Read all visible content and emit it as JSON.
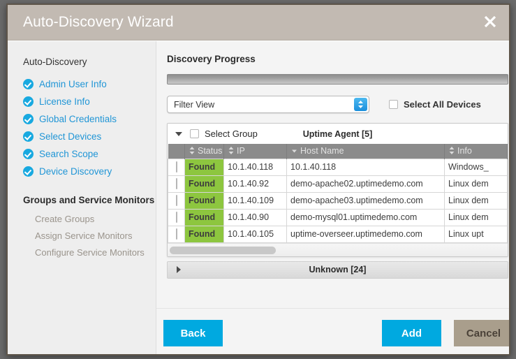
{
  "window": {
    "title": "Auto-Discovery Wizard",
    "close_icon": "close-icon"
  },
  "sidebar": {
    "section_title": "Auto-Discovery",
    "steps": [
      {
        "label": "Admin User Info",
        "icon": "check-circle-icon",
        "complete": true
      },
      {
        "label": "License Info",
        "icon": "check-circle-icon",
        "complete": true
      },
      {
        "label": "Global Credentials",
        "icon": "check-circle-icon",
        "complete": true
      },
      {
        "label": "Select Devices",
        "icon": "check-circle-icon",
        "complete": true
      },
      {
        "label": "Search Scope",
        "icon": "check-circle-icon",
        "complete": true
      },
      {
        "label": "Device Discovery",
        "icon": "check-circle-icon",
        "complete": true
      }
    ],
    "group_title": "Groups and Service Monitors",
    "group_items": [
      {
        "label": "Create Groups"
      },
      {
        "label": "Assign Service Monitors"
      },
      {
        "label": "Configure Service Monitors"
      }
    ]
  },
  "main": {
    "progress_label": "Discovery Progress",
    "progress_percent": 100,
    "filter": {
      "value": "Filter View",
      "chevron_icon": "updown-chevron-icon"
    },
    "select_all": {
      "label": "Select All Devices",
      "checked": false
    },
    "group_uptime": {
      "toggle_icon": "triangle-down-icon",
      "select_group_label": "Select Group",
      "select_group_checked": false,
      "title": "Uptime Agent [5]",
      "expanded": true
    },
    "table": {
      "columns": [
        {
          "key": "check",
          "label": "",
          "sort": "none"
        },
        {
          "key": "status",
          "label": "Status",
          "sort": "both"
        },
        {
          "key": "ip",
          "label": "IP",
          "sort": "both"
        },
        {
          "key": "host",
          "label": "Host Name",
          "sort": "desc"
        },
        {
          "key": "info",
          "label": "Info",
          "sort": "both"
        }
      ],
      "rows": [
        {
          "checked": false,
          "status": "Found",
          "ip": "10.1.40.118",
          "host": "10.1.40.118",
          "info": "Windows_"
        },
        {
          "checked": false,
          "status": "Found",
          "ip": "10.1.40.92",
          "host": "demo-apache02.uptimedemo.com",
          "info": "Linux dem"
        },
        {
          "checked": false,
          "status": "Found",
          "ip": "10.1.40.109",
          "host": "demo-apache03.uptimedemo.com",
          "info": "Linux dem"
        },
        {
          "checked": false,
          "status": "Found",
          "ip": "10.1.40.90",
          "host": "demo-mysql01.uptimedemo.com",
          "info": "Linux dem"
        },
        {
          "checked": false,
          "status": "Found",
          "ip": "10.1.40.105",
          "host": "uptime-overseer.uptimedemo.com",
          "info": "Linux upt"
        }
      ]
    },
    "group_unknown": {
      "toggle_icon": "triangle-right-icon",
      "title": "Unknown [24]",
      "expanded": false
    }
  },
  "footer": {
    "back_label": "Back",
    "add_label": "Add",
    "cancel_label": "Cancel"
  },
  "colors": {
    "titlebar": "#c2bab2",
    "accent_blue": "#00a9e0",
    "link_blue": "#2196d6",
    "status_green": "#8dc63f",
    "cancel_tan": "#a99e8c"
  }
}
